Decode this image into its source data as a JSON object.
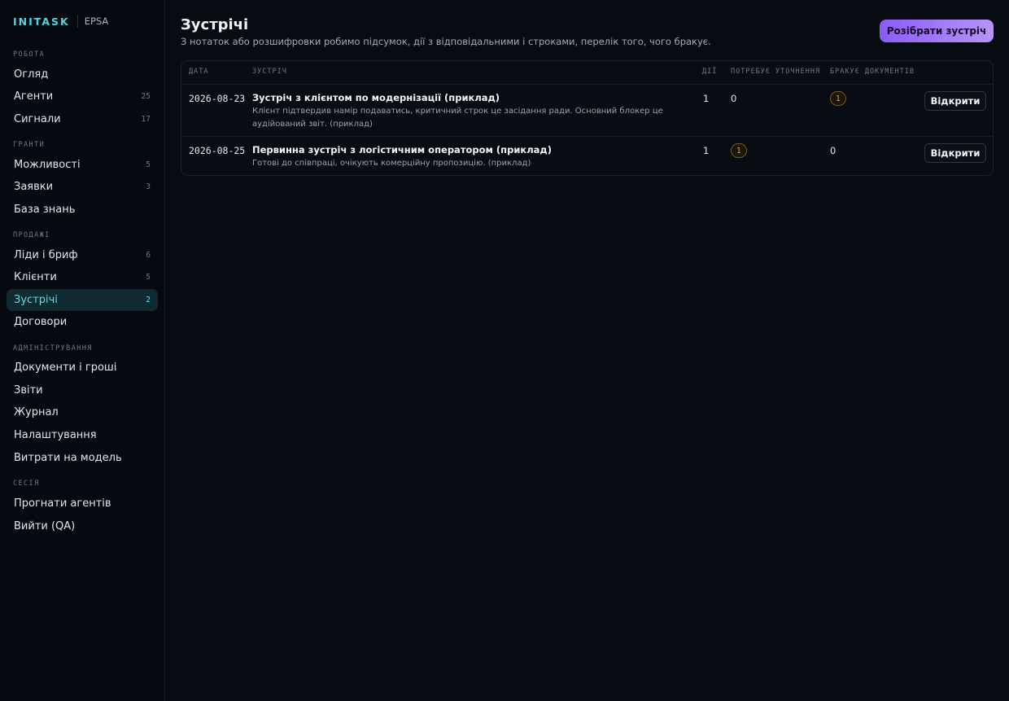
{
  "brand": {
    "name": "INITASK",
    "sub": "EPSA"
  },
  "sections": {
    "work": "РОБОТА",
    "grants": "ГРАНТИ",
    "sales": "ПРОДАЖІ",
    "admin": "АДМІНІСТРУВАННЯ",
    "session": "СЕСІЯ"
  },
  "nav": {
    "overview": {
      "label": "Огляд"
    },
    "agents": {
      "label": "Агенти",
      "count": "25"
    },
    "signals": {
      "label": "Сигнали",
      "count": "17"
    },
    "opportunities": {
      "label": "Можливості",
      "count": "5"
    },
    "applications": {
      "label": "Заявки",
      "count": "3"
    },
    "knowledge": {
      "label": "База знань"
    },
    "leads": {
      "label": "Ліди і бриф",
      "count": "6"
    },
    "clients": {
      "label": "Клієнти",
      "count": "5"
    },
    "meetings": {
      "label": "Зустрічі",
      "count": "2"
    },
    "contracts": {
      "label": "Договори"
    },
    "docs_money": {
      "label": "Документи і гроші"
    },
    "reports": {
      "label": "Звіти"
    },
    "journal": {
      "label": "Журнал"
    },
    "settings": {
      "label": "Налаштування"
    },
    "model_costs": {
      "label": "Витрати на модель"
    },
    "run_agents": {
      "label": "Прогнати агентів"
    },
    "logout": {
      "label": "Вийти (QA)"
    }
  },
  "header": {
    "title": "Зустрічі",
    "subtitle": "З нотаток або розшифровки робимо підсумок, дії з відповідальними і строками, перелік того, чого бракує.",
    "action_label": "Розібрати зустріч"
  },
  "table": {
    "columns": {
      "date": "ДАТА",
      "meeting": "ЗУСТРІЧ",
      "actions": "ДІЇ",
      "clarify": "ПОТРЕБУЄ УТОЧНЕННЯ",
      "missing": "БРАКУЄ ДОКУМЕНТІВ"
    },
    "open_label": "Відкрити",
    "rows": [
      {
        "date": "2026-08-23",
        "title": "Зустріч з клієнтом по модернізації (приклад)",
        "desc": "Клієнт підтвердив намір подаватись, критичний строк це засідання ради. Основний блокер це аудійований звіт. (приклад)",
        "actions": "1",
        "clarify": "0",
        "missing": "1"
      },
      {
        "date": "2026-08-25",
        "title": "Первинна зустріч з логістичним оператором (приклад)",
        "desc": "Готові до співпраці, очікують комерційну пропозицію. (приклад)",
        "actions": "1",
        "clarify": "1",
        "missing": "0"
      }
    ]
  },
  "colors": {
    "accent": "#5fdde3",
    "primary": "#8b5cf6",
    "warning": "#d9a43a"
  }
}
